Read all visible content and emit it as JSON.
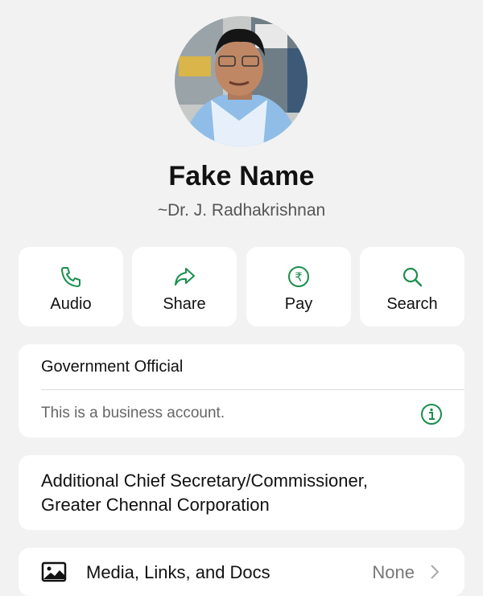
{
  "profile": {
    "name": "Fake Name",
    "subtitle": "~Dr. J. Radhakrishnan",
    "avatar_desc": "profile-photo"
  },
  "actions": [
    {
      "label": "Audio",
      "icon": "phone-icon"
    },
    {
      "label": "Share",
      "icon": "share-arrow-icon"
    },
    {
      "label": "Pay",
      "icon": "rupee-icon"
    },
    {
      "label": "Search",
      "icon": "search-icon"
    }
  ],
  "business": {
    "category": "Government Official",
    "note": "This is a business account.",
    "icon": "info-icon"
  },
  "about": {
    "line1": "Additional Chief Secretary/Commissioner,",
    "line2": "Greater Chennal Corporation"
  },
  "media": {
    "label": "Media, Links, and Docs",
    "value": "None",
    "icon": "image-icon"
  },
  "colors": {
    "accent": "#1a8f4c",
    "background": "#f2f2f3",
    "card": "#ffffff"
  }
}
